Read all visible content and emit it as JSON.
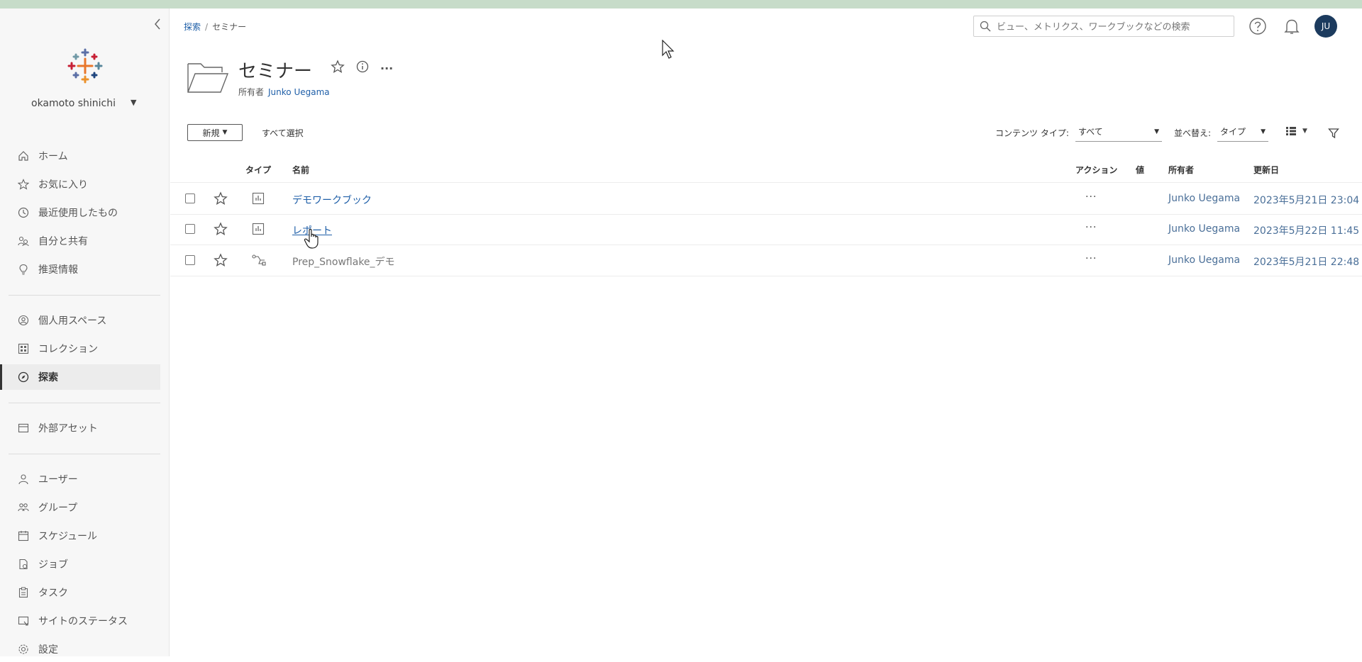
{
  "sidebar": {
    "user_name": "okamoto shinichi",
    "nav_primary": [
      {
        "label": "ホーム",
        "icon": "home-icon"
      },
      {
        "label": "お気に入り",
        "icon": "star-icon"
      },
      {
        "label": "最近使用したもの",
        "icon": "clock-icon"
      },
      {
        "label": "自分と共有",
        "icon": "share-icon"
      },
      {
        "label": "推奨情報",
        "icon": "lightbulb-icon"
      }
    ],
    "nav_secondary": [
      {
        "label": "個人用スペース",
        "icon": "person-circle-icon"
      },
      {
        "label": "コレクション",
        "icon": "collection-icon"
      },
      {
        "label": "探索",
        "icon": "compass-icon",
        "active": true
      }
    ],
    "nav_tertiary": [
      {
        "label": "外部アセット",
        "icon": "external-assets-icon"
      }
    ],
    "nav_admin": [
      {
        "label": "ユーザー",
        "icon": "user-icon"
      },
      {
        "label": "グループ",
        "icon": "group-icon"
      },
      {
        "label": "スケジュール",
        "icon": "calendar-icon"
      },
      {
        "label": "ジョブ",
        "icon": "job-icon"
      },
      {
        "label": "タスク",
        "icon": "task-icon"
      },
      {
        "label": "サイトのステータス",
        "icon": "site-status-icon"
      },
      {
        "label": "設定",
        "icon": "gear-icon"
      }
    ]
  },
  "breadcrumb": {
    "parent": "探索",
    "separator": "/",
    "current": "セミナー"
  },
  "search": {
    "placeholder": "ビュー、メトリクス、ワークブックなどの検索"
  },
  "header": {
    "avatar_initials": "JU"
  },
  "page": {
    "title": "セミナー",
    "owner_label": "所有者",
    "owner_name": "Junko Uegama",
    "more": "···"
  },
  "toolbar": {
    "new_label": "新規",
    "select_all": "すべて選択",
    "content_type_label": "コンテンツ タイプ:",
    "content_type_value": "すべて",
    "sort_label": "並べ替え:",
    "sort_value": "タイプ"
  },
  "table": {
    "headers": {
      "type": "タイプ",
      "name": "名前",
      "action": "アクション",
      "value": "値",
      "owner": "所有者",
      "modified": "更新日"
    },
    "rows": [
      {
        "type_icon": "workbook-icon",
        "name": "デモワークブック",
        "action": "···",
        "owner": "Junko Uegama",
        "modified": "2023年5月21日 23:04"
      },
      {
        "type_icon": "workbook-icon",
        "name": "レポート",
        "action": "···",
        "owner": "Junko Uegama",
        "modified": "2023年5月22日 11:45"
      },
      {
        "type_icon": "flow-icon",
        "name": "Prep_Snowflake_デモ",
        "action": "···",
        "owner": "Junko Uegama",
        "modified": "2023年5月21日 22:48"
      }
    ]
  },
  "colors": {
    "link": "#1f5fa8",
    "avatar": "#1c3b5e",
    "top_strip": "#c7dcc9"
  }
}
